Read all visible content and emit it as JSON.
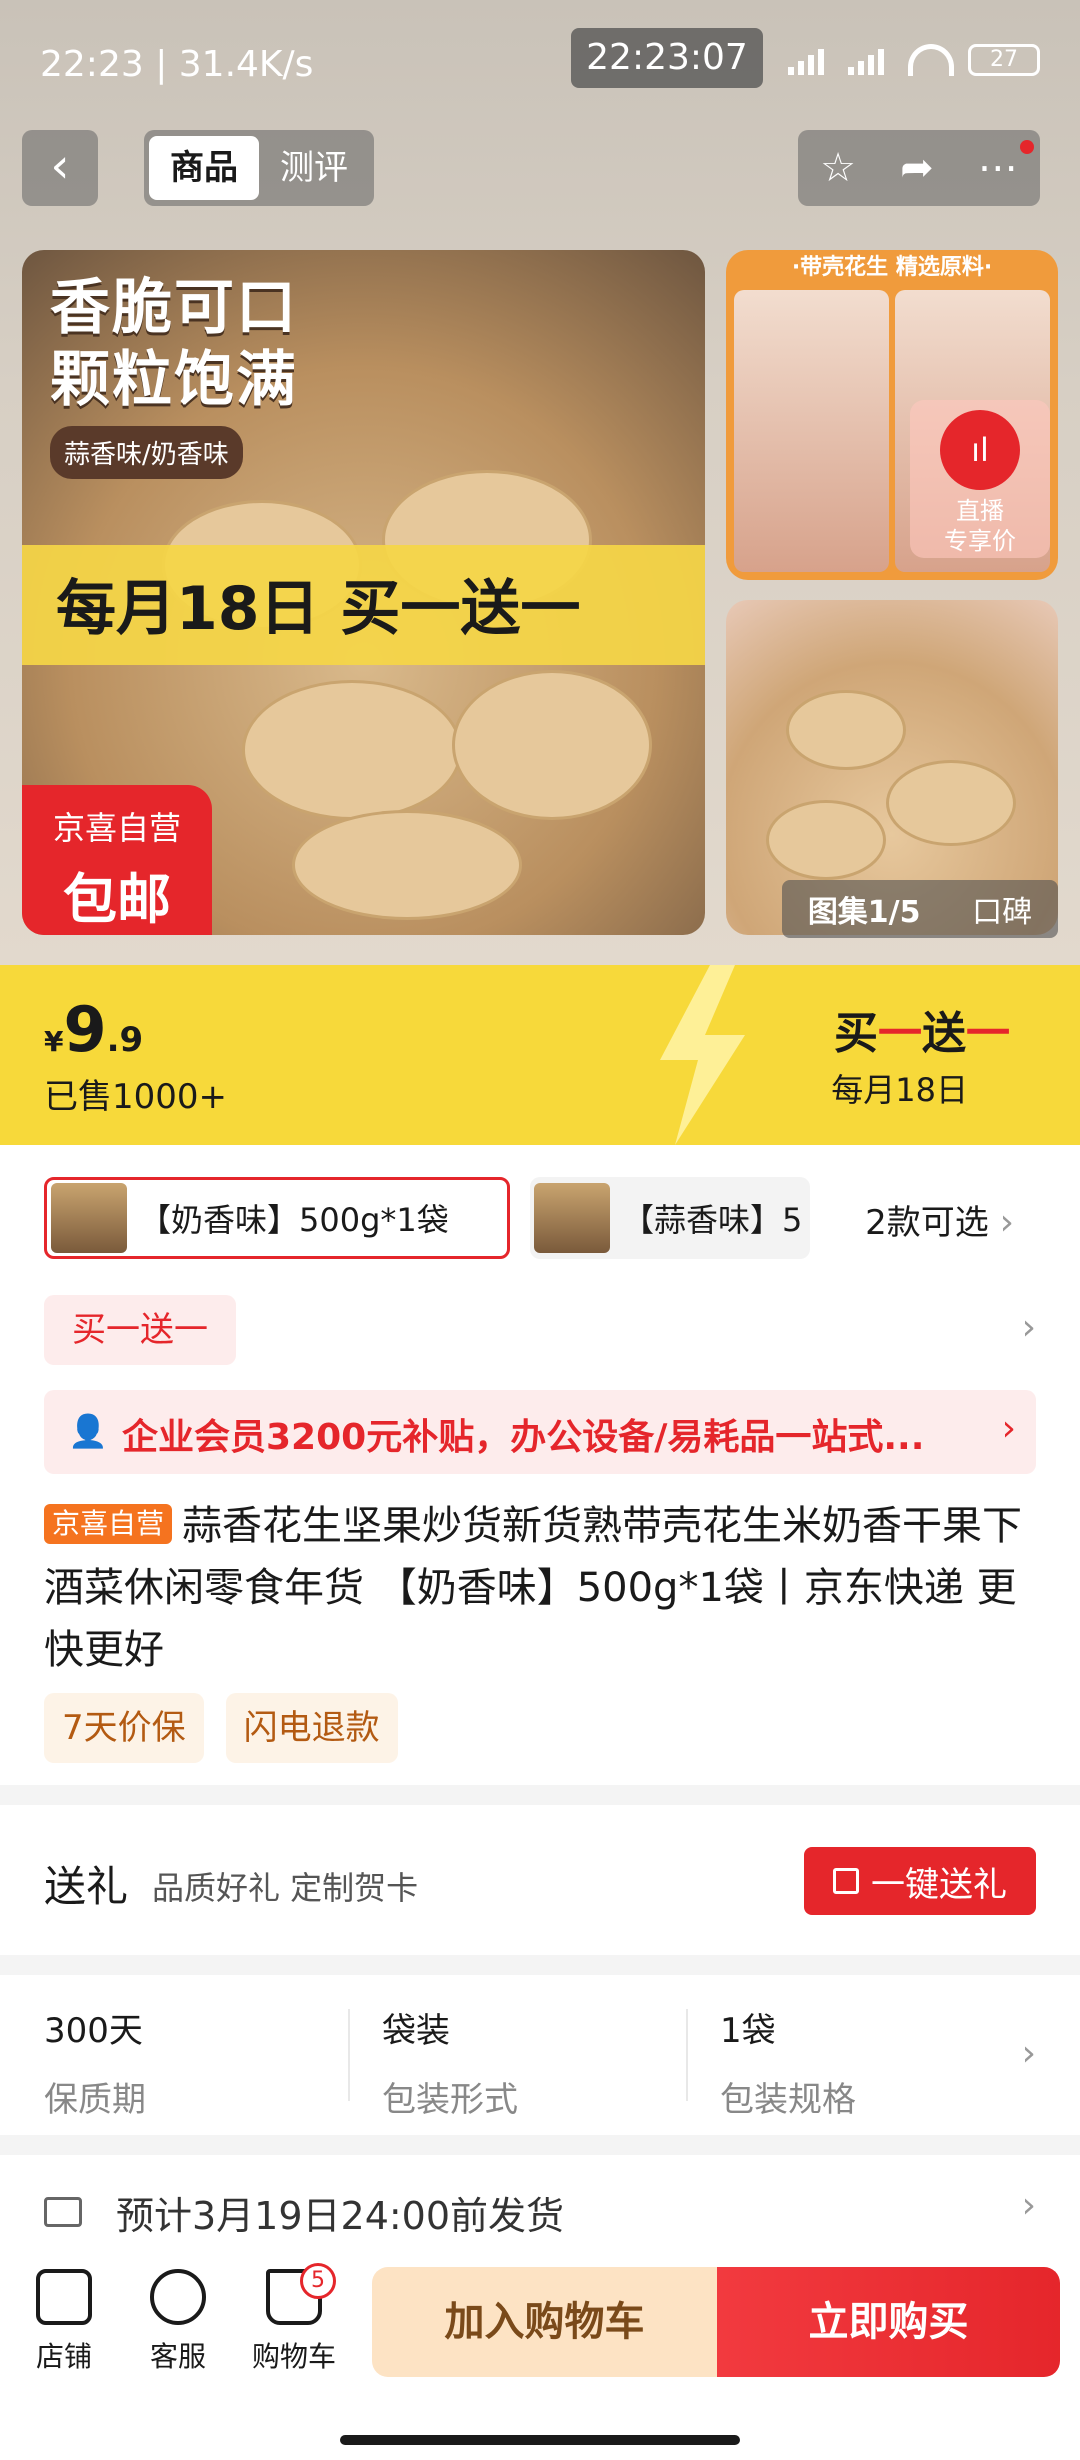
{
  "status_bar": {
    "time_speed": "22:23 | 31.4K/s",
    "center_time": "22:23:07",
    "battery": "27"
  },
  "nav": {
    "back": "‹",
    "tabs": [
      "商品",
      "测评"
    ],
    "icons": [
      "star-icon",
      "share-icon",
      "more-icon"
    ]
  },
  "gallery": {
    "main_title_line1": "香脆可口",
    "main_title_line2": "颗粒饱满",
    "flavors": "蒜香味/奶香味",
    "band_text": "每月18日 买一送一",
    "badge_line1": "京喜自营",
    "badge_line2": "包邮",
    "side_header": "·带壳花生  精选原料·",
    "live_line1": "直播",
    "live_line2": "专享价",
    "gallery_label": "图集1/5",
    "reviews_label": "口碑"
  },
  "price": {
    "currency": "¥",
    "integer": "9",
    "decimal": ".9",
    "sold": "已售1000+",
    "promo_prefix": "买",
    "promo_mid": "一",
    "promo_mid2": "送",
    "promo_end": "一",
    "promo_sub": "每月18日"
  },
  "variants": {
    "selected": "【奶香味】500g*1袋",
    "other": "【蒜香味】5",
    "more": "2款可选"
  },
  "promo_tag": "买一送一",
  "member_banner": "企业会员3200元补贴，办公设备/易耗品一站式...",
  "product": {
    "store_tag": "京喜自营",
    "title": "蒜香花生坚果炒货新货熟带壳花生米奶香干果下酒菜休闲零食年货 【奶香味】500g*1袋丨京东快递 更快更好",
    "guarantees": [
      "7天价保",
      "闪电退款"
    ]
  },
  "gift": {
    "title": "送礼",
    "subtitle": "品质好礼 定制贺卡",
    "button": "一键送礼"
  },
  "specs": [
    {
      "value": "300天",
      "label": "保质期"
    },
    {
      "value": "袋装",
      "label": "包装形式"
    },
    {
      "value": "1袋",
      "label": "包装规格"
    }
  ],
  "delivery": "预计3月19日24:00前发货",
  "bottom_bar": {
    "store": "店铺",
    "service": "客服",
    "cart": "购物车",
    "cart_count": "5",
    "add_to_cart": "加入购物车",
    "buy_now": "立即购买"
  },
  "colors": {
    "accent_red": "#e5262b",
    "price_yellow": "#f7d93a",
    "store_orange": "#f5731f"
  }
}
